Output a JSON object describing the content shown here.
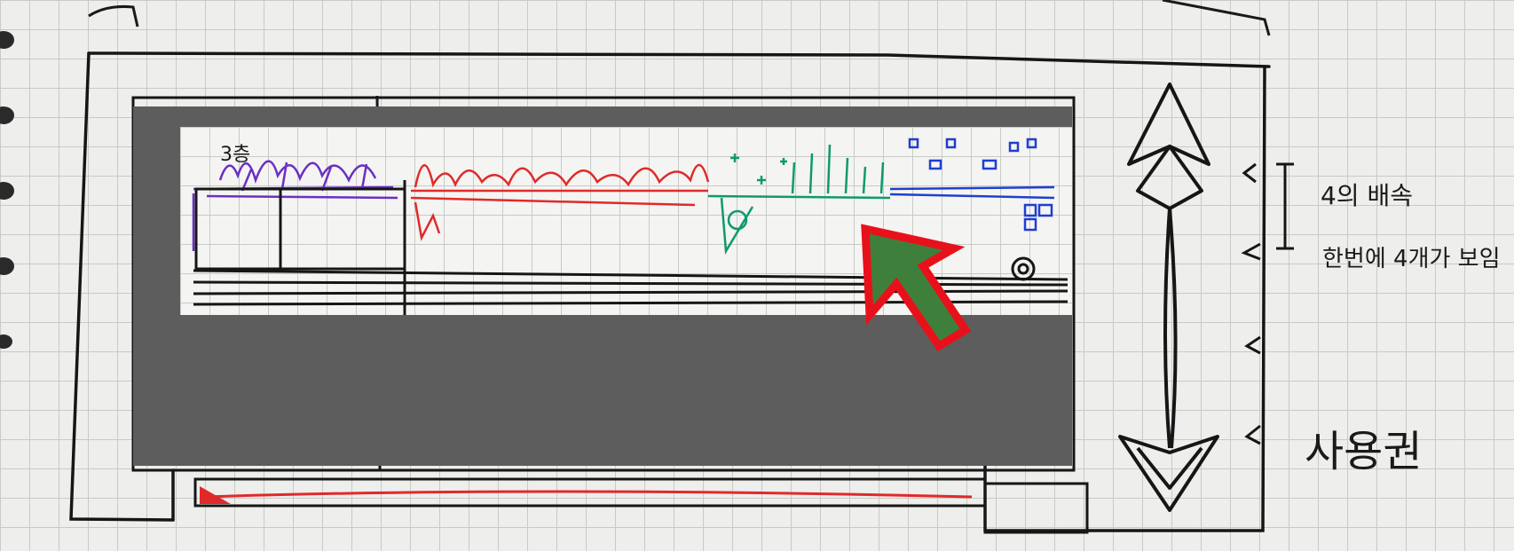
{
  "sketch": {
    "corner_note": "3층",
    "side_note_line1": "4의 배속",
    "side_note_line2": "한번에 4개가 보임",
    "bottom_note": "사용권"
  },
  "zones": [
    {
      "name": "purple",
      "color": "#6a2fc4"
    },
    {
      "name": "red",
      "color": "#e02a2a"
    },
    {
      "name": "green",
      "color": "#0e9a6c"
    },
    {
      "name": "blue",
      "color": "#1f3fcf"
    }
  ],
  "overlay": {
    "dim_color": "#5d5d5d",
    "highlight_color": "#ffffff",
    "arrow_fill": "#3f7f3c",
    "arrow_stroke": "#e8111b"
  }
}
